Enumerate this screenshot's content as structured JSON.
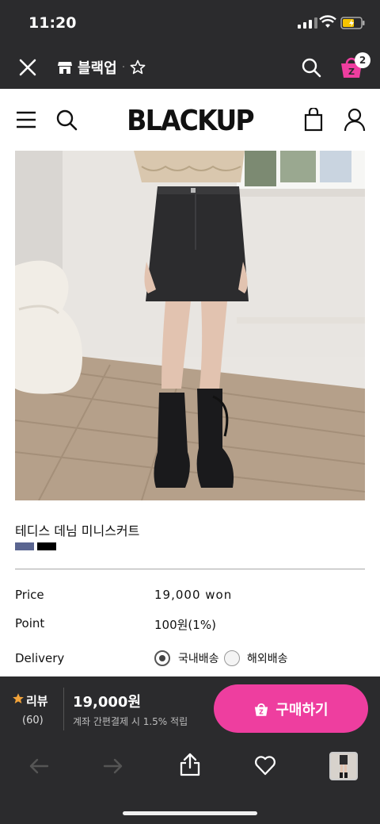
{
  "status_bar": {
    "time": "11:20"
  },
  "app_bar": {
    "store_name": "블랙업",
    "cart_count": "2"
  },
  "site_header": {
    "logo": "BLACKUP"
  },
  "product": {
    "name": "테디스 데님 미니스커트",
    "swatches": [
      "#5a6590",
      "#000000"
    ],
    "details": [
      {
        "label": "Price",
        "value": "19,000 won"
      },
      {
        "label": "Point",
        "value": "100원(1%)"
      },
      {
        "label": "Delivery",
        "value": ""
      }
    ],
    "delivery_options": [
      {
        "label": "국내배송",
        "selected": true
      },
      {
        "label": "해외배송",
        "selected": false
      }
    ]
  },
  "purchase_bar": {
    "review_label": "리뷰",
    "review_count": "(60)",
    "price": "19,000원",
    "payment_note": "계좌 간편결제 시 1.5% 적립",
    "buy_label": "구매하기",
    "buy_color": "#ee3e9f"
  },
  "icons": [
    "close-icon",
    "store-icon",
    "star-outline-icon",
    "search-icon",
    "cart-icon",
    "menu-icon",
    "bag-icon",
    "user-icon",
    "star-icon",
    "back-icon",
    "forward-icon",
    "share-icon",
    "heart-icon"
  ]
}
